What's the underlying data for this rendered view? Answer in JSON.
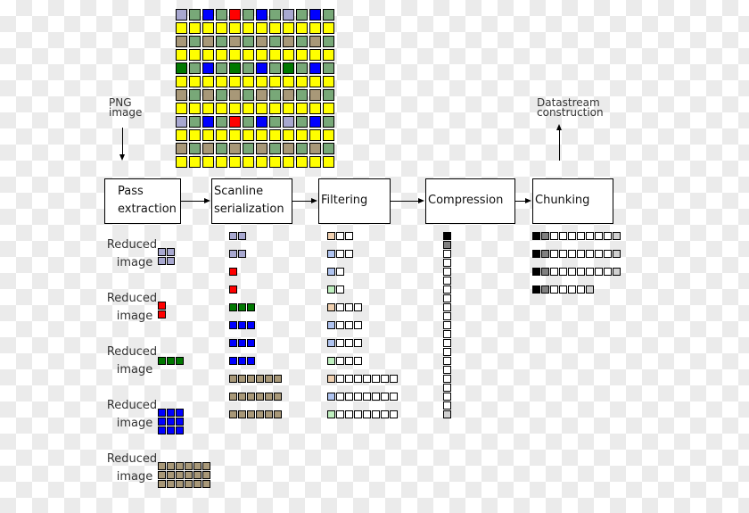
{
  "palette": {
    "L": "#a8a8d0",
    "S": "#78a878",
    "B": "#0000ff",
    "R": "#ff0000",
    "G": "#007800",
    "T": "#a89878",
    "Y": "#ffff00",
    "fp": "#f0d0b0",
    "fb": "#b0c4f0",
    "fg": "#c0f0c0",
    "w": "#ffffff",
    "k": "#000000",
    "d": "#808080",
    "l": "#d0d0d0"
  },
  "source_image": [
    "LSBSRSBSLSBS",
    "YYYYYYYYYYYY",
    "TSTSTSTSTSTS",
    "YYYYYYYYYYYY",
    "GSBSGSBSGSBS",
    "YYYYYYYYYYYY",
    "TSTSTSTSTSTS",
    "YYYYYYYYYYYY",
    "LSBSRSBSLSBS",
    "YYYYYYYYYYYY",
    "TSTSTSTSTSTS",
    "YYYYYYYYYYYY"
  ],
  "input_label": "PNG image",
  "output_label": "Datastream construction",
  "stages": [
    {
      "label": "Pass extraction"
    },
    {
      "label": "Scanline serialization"
    },
    {
      "label": "Filtering"
    },
    {
      "label": "Compression"
    },
    {
      "label": "Chunking"
    }
  ],
  "reduced_images": [
    {
      "label": "Reduced image",
      "rows": [
        "LL",
        "LL"
      ]
    },
    {
      "label": "Reduced image",
      "rows": [
        "R",
        "R"
      ]
    },
    {
      "label": "Reduced image",
      "rows": [
        "GGG"
      ]
    },
    {
      "label": "Reduced image",
      "rows": [
        "BBB",
        "BBB",
        "BBB"
      ]
    },
    {
      "label": "Reduced image",
      "rows": [
        "TTTTTT",
        "TTTTTT",
        "TTTTTT"
      ]
    }
  ],
  "scanlines": [
    "LL",
    "LL",
    "R",
    "R",
    "GGG",
    "BBB",
    "BBB",
    "BBB",
    "TTTTTT",
    "TTTTTT",
    "TTTTTT"
  ],
  "filtered": [
    "fp w w",
    "fb w w",
    "fb w",
    "fg w",
    "fp w w w",
    "fb w w w",
    "fb w w w",
    "fg w w w",
    "fp w w w w w w w",
    "fb w w w w w w w",
    "fg w w w w w w w"
  ],
  "compressed": "k d w w w w w w w w w w w w w w w w w w l",
  "chunks": [
    "k d w w w w w w w l",
    "k d w w w w w w w l",
    "k d w w w w w w w l",
    "k d w w w w l"
  ]
}
